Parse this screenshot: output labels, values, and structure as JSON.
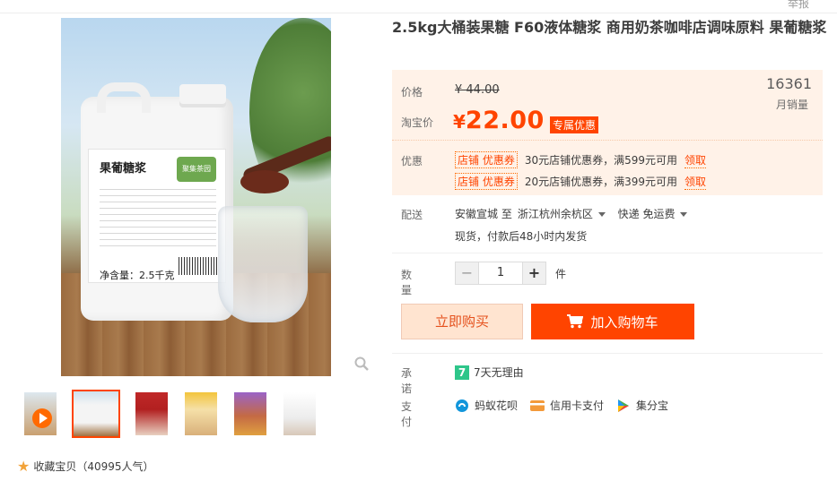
{
  "header": {
    "report": "举报"
  },
  "product": {
    "title": "2.5kg大桶装果糖 F60液体糖浆 商用奶茶咖啡店调味原料 果葡糖浆",
    "image_label_title": "果葡糖浆",
    "image_label_brand": "聚集茶园",
    "image_label_net": "净含量：2.5千克"
  },
  "price": {
    "label": "价格",
    "original": "¥ 44.00",
    "taobao_label": "淘宝价",
    "symbol": "¥",
    "current": "22.00",
    "exclusive_tag": "专属优惠",
    "sales_count": "16361",
    "sales_label": "月销量"
  },
  "coupons": {
    "label": "优惠",
    "items": [
      {
        "tag": "店铺 优惠券",
        "desc": "30元店铺优惠券，满599元可用",
        "claim": "领取"
      },
      {
        "tag": "店铺 优惠券",
        "desc": "20元店铺优惠券，满399元可用",
        "claim": "领取"
      }
    ]
  },
  "delivery": {
    "label": "配送",
    "from": "安徽宣城 至",
    "to": "浙江杭州余杭区",
    "shipping": "快递 免运费",
    "note": "现货，付款后48小时内发货"
  },
  "quantity": {
    "label": "数量",
    "minus": "−",
    "value": "1",
    "plus": "+",
    "unit": "件"
  },
  "actions": {
    "buy_now": "立即购买",
    "add_cart": "加入购物车"
  },
  "promise": {
    "label": "承诺",
    "badge": "7",
    "text": "7天无理由"
  },
  "payment": {
    "label": "支付",
    "methods": [
      {
        "icon": "huabei-icon",
        "text": "蚂蚁花呗"
      },
      {
        "icon": "credit-card-icon",
        "text": "信用卡支付"
      },
      {
        "icon": "jifenbao-icon",
        "text": "集分宝"
      }
    ]
  },
  "favorite": {
    "text": "收藏宝贝（40995人气）"
  },
  "colors": {
    "accent": "#ff4400",
    "price_box": "#fff2e8",
    "buy_bg": "#ffe4d0"
  }
}
